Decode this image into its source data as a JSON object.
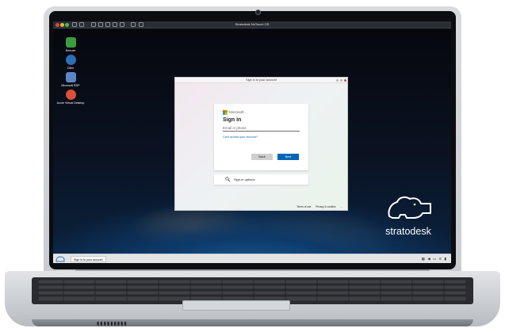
{
  "os_topbar": {
    "title": "Stratodesk NoTouch OS"
  },
  "desktop_icons": [
    {
      "label": "Remote",
      "icon": "monitor-icon",
      "color": "#3a9c3a"
    },
    {
      "label": "Citrix",
      "icon": "citrix-icon",
      "color": "#2f6fb3"
    },
    {
      "label": "Microsoft RDP",
      "icon": "rdp-icon",
      "color": "#5b86c5"
    },
    {
      "label": "Azure Virtual Desktop",
      "icon": "azure-icon",
      "color": "#d94f3a"
    }
  ],
  "window": {
    "title": "Sign in to your account"
  },
  "signin": {
    "brand": "Microsoft",
    "heading": "Sign in",
    "email_placeholder": "Email or phone",
    "cant_access": "Can't access your account?",
    "back_label": "Back",
    "next_label": "Next"
  },
  "sign_in_options": {
    "label": "Sign-in options"
  },
  "footer": {
    "terms": "Terms of use",
    "privacy": "Privacy & cookies",
    "more": "..."
  },
  "brand": {
    "name": "stratodesk"
  },
  "taskbar": {
    "task_label": "Sign in to your account"
  },
  "colors": {
    "accent": "#0067b8",
    "ms_red": "#f25022",
    "ms_green": "#7fba00",
    "ms_blue": "#00a4ef",
    "ms_yellow": "#ffb900"
  }
}
